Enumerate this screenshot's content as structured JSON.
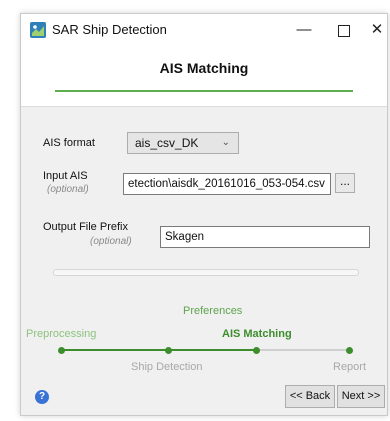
{
  "window": {
    "title": "SAR Ship Detection",
    "minimize_glyph": "—",
    "close_glyph": "✕"
  },
  "header": {
    "title": "AIS Matching"
  },
  "form": {
    "ais_format": {
      "label": "AIS format",
      "value": "ais_csv_DK"
    },
    "input_ais": {
      "label": "Input AIS",
      "optional": "(optional)",
      "value": "etection\\aisdk_20161016_053-054.csv",
      "browse_label": "..."
    },
    "output_prefix": {
      "label": "Output File Prefix",
      "optional": "(optional)",
      "value": "Skagen"
    }
  },
  "wizard": {
    "steps": {
      "preferences": "Preferences",
      "preprocessing": "Preprocessing",
      "ais_matching": "AIS Matching",
      "ship_detection": "Ship Detection",
      "report": "Report"
    },
    "colors": {
      "done": "#5fa44e",
      "current": "#2f7d22",
      "pending": "#c8c8c8"
    }
  },
  "footer": {
    "help_glyph": "?",
    "back_label": "<< Back",
    "next_label": "Next >>"
  },
  "icons": [
    "app-icon",
    "minimize-icon",
    "maximize-icon",
    "close-icon",
    "chevron-down-icon",
    "help-icon"
  ]
}
